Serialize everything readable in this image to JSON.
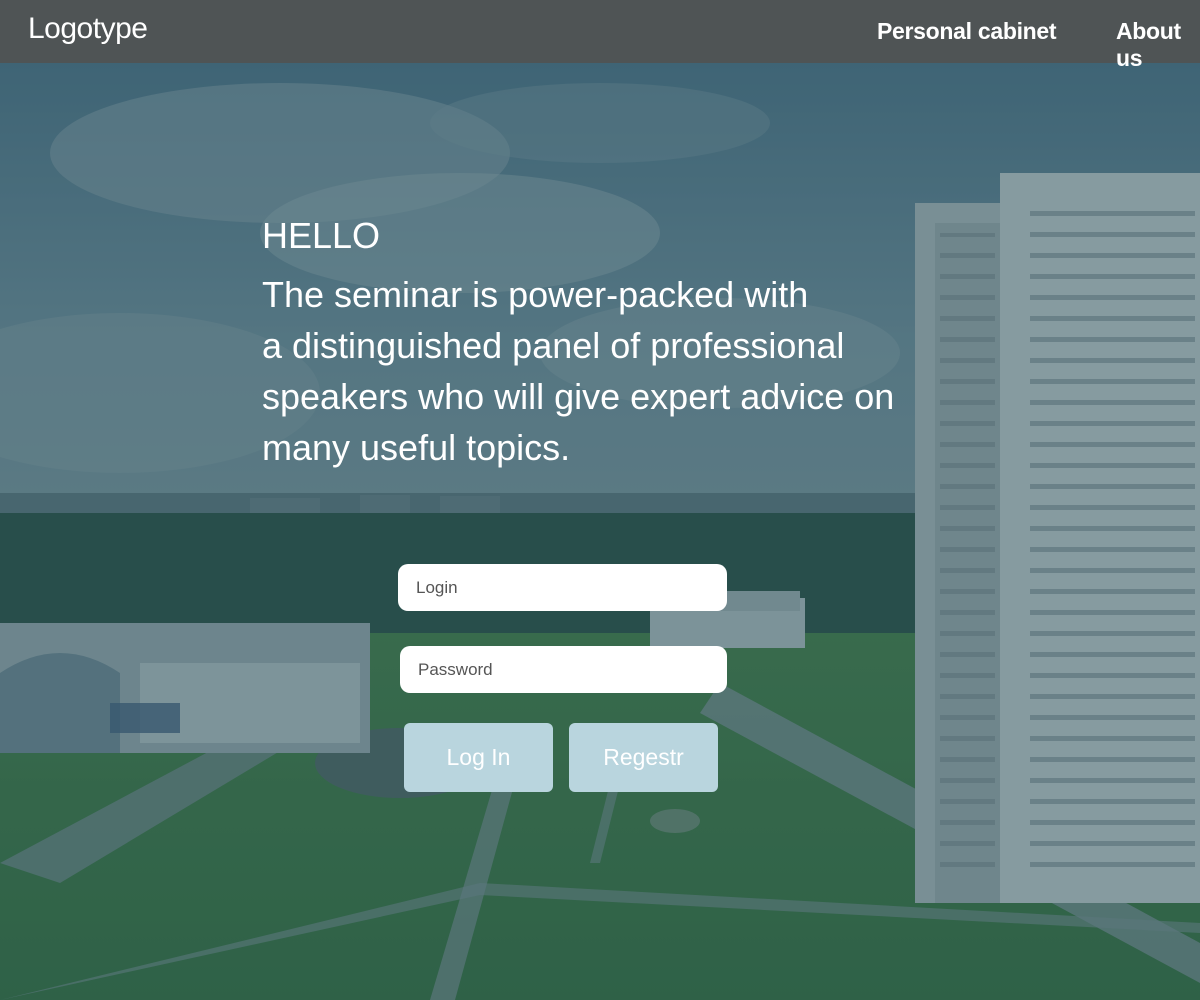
{
  "header": {
    "logo": "Logotype",
    "nav": [
      {
        "label": "Personal cabinet"
      },
      {
        "label": "About us"
      }
    ]
  },
  "hero": {
    "title": "HELLO",
    "text": "The seminar is power-packed with\na distinguished panel of professional\nspeakers who will give expert advice on\nmany useful topics."
  },
  "form": {
    "login_placeholder": "Login",
    "password_placeholder": "Password",
    "login_button": "Log In",
    "register_button": "Regestr"
  },
  "colors": {
    "header_bg": "#4f5455",
    "button_bg": "#b9d5de",
    "overlay": "#2f5563"
  }
}
